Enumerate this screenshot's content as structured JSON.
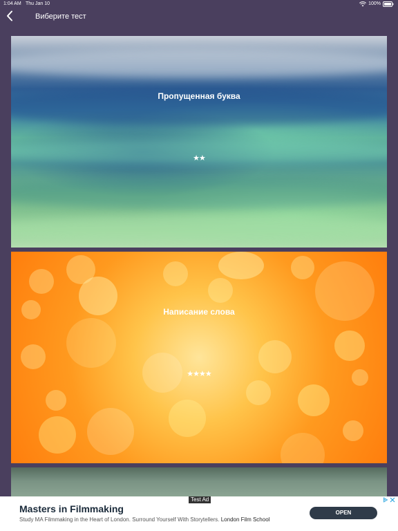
{
  "status_bar": {
    "time": "1:04 AM",
    "date": "Thu Jan 10",
    "battery": "100%"
  },
  "nav": {
    "back_icon": "chevron-left-icon",
    "title": "Виберите тест"
  },
  "tests": [
    {
      "title": "Пропущенная буква",
      "stars": "★★",
      "star_count": 2
    },
    {
      "title": "Написание слова",
      "stars": "★★★★",
      "star_count": 4
    },
    {
      "title": "",
      "stars": ""
    }
  ],
  "ad": {
    "badge": "Test Ad",
    "headline": "Masters in Filmmaking",
    "body": "Study MA Filmmaking in the Heart of London. Surround Yourself With Storytellers.",
    "advertiser": "London Film School",
    "cta": "OPEN",
    "close_icon": "close-icon",
    "adchoices_icon": "adchoices-icon"
  },
  "colors": {
    "background": "#4a3f5e",
    "ad_button": "#2f3b49",
    "ad_icon": "#2aa6e0"
  }
}
